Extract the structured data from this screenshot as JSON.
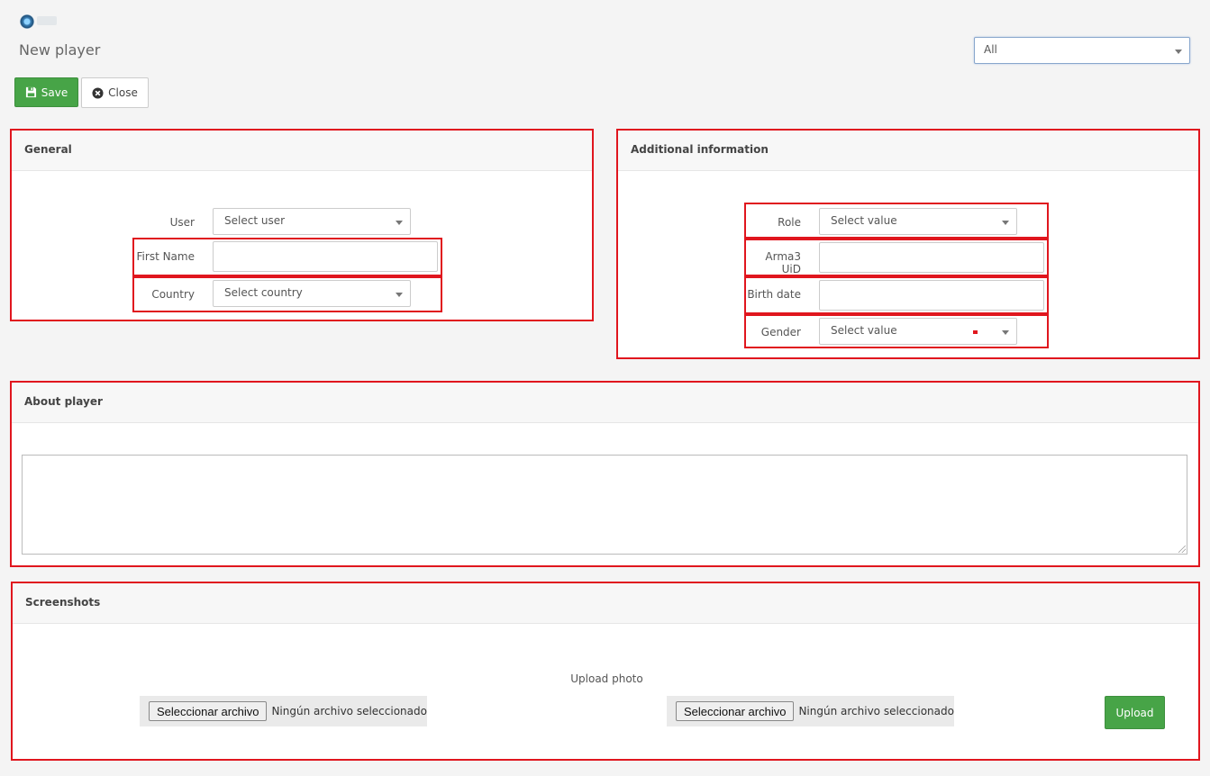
{
  "header": {
    "title": "New player",
    "filter_value": "All"
  },
  "toolbar": {
    "save_label": "Save",
    "close_label": "Close"
  },
  "general": {
    "title": "General",
    "user_label": "User",
    "user_value": "Select user",
    "first_name_label": "First Name",
    "first_name_value": "",
    "country_label": "Country",
    "country_value": "Select country"
  },
  "additional": {
    "title": "Additional information",
    "role_label": "Role",
    "role_value": "Select value",
    "uid_label": "Arma3 UiD",
    "uid_value": "",
    "birth_label": "Birth date",
    "birth_value": "",
    "gender_label": "Gender",
    "gender_value": "Select value"
  },
  "about": {
    "title": "About player",
    "text": ""
  },
  "screenshots": {
    "title": "Screenshots",
    "upload_label": "Upload photo",
    "file_button": "Seleccionar archivo",
    "file_status": "Ningún archivo seleccionado",
    "upload_button": "Upload"
  },
  "colors": {
    "accent_green": "#47a447",
    "highlight_red": "#e0161e"
  }
}
